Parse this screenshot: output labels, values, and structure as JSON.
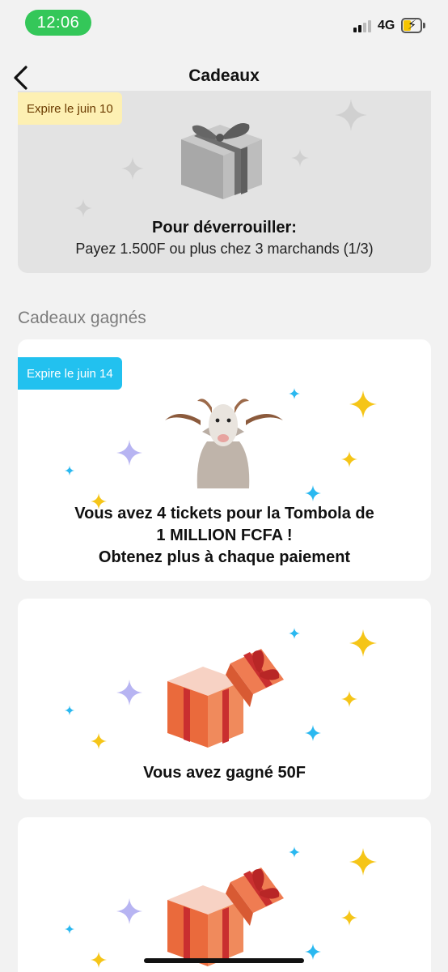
{
  "status_bar": {
    "time": "12:06",
    "network": "4G"
  },
  "nav": {
    "title": "Cadeaux"
  },
  "locked_gift": {
    "expiry": "Expire le juin 10",
    "unlock_title": "Pour déverrouiller:",
    "unlock_desc": "Payez 1.500F ou plus chez 3 marchands (1/3)"
  },
  "section": {
    "label": "Cadeaux gagnés"
  },
  "won_gifts": [
    {
      "expiry": "Expire le juin 14",
      "line1": "Vous avez 4 tickets pour la Tombola de",
      "line2": "1 MILLION FCFA !",
      "line3": "Obtenez plus à chaque paiement"
    },
    {
      "text": "Vous avez gagné 50F"
    }
  ],
  "colors": {
    "accent_green": "#34c759",
    "badge_blue": "#22c1ef",
    "badge_yellow": "#fdf0b3",
    "sparkle_gold": "#f5c518",
    "sparkle_purple": "#b7b4f2",
    "sparkle_blue": "#2ab8f0",
    "gift_orange": "#ea6a3c"
  }
}
